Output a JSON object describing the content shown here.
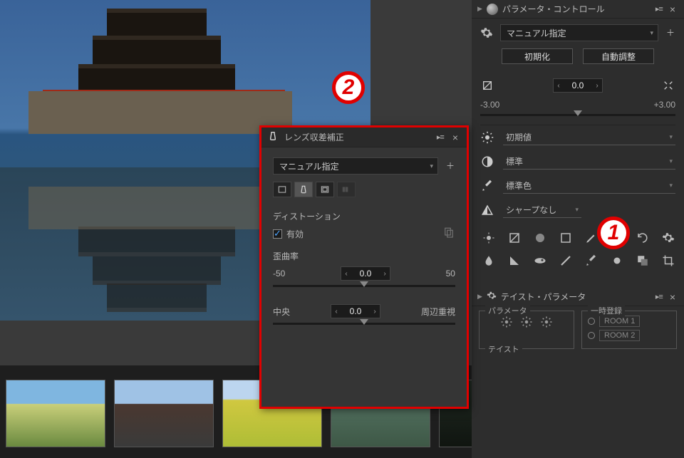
{
  "annotations": {
    "badge1": "1",
    "badge2": "2"
  },
  "rightPanel": {
    "paramControl": {
      "title": "パラメータ・コントロール",
      "preset": "マニュアル指定",
      "btnInit": "初期化",
      "btnAuto": "自動調整"
    },
    "exposure": {
      "value": "0.0",
      "min": "-3.00",
      "max": "+3.00"
    },
    "props": {
      "wb": "初期値",
      "tone": "標準",
      "color": "標準色",
      "sharp": "シャープなし"
    },
    "taste": {
      "title": "テイスト・パラメータ",
      "groupParam": "パラメータ",
      "groupTemp": "一時登録",
      "groupTaste": "テイスト",
      "room1": "ROOM 1",
      "room2": "ROOM 2"
    }
  },
  "popup": {
    "title": "レンズ収差補正",
    "preset": "マニュアル指定",
    "sectionDistortion": "ディストーション",
    "enable": "有効",
    "labelCurvature": "歪曲率",
    "curvature": {
      "value": "0.0",
      "min": "-50",
      "max": "50"
    },
    "center": {
      "labelLeft": "中央",
      "value": "0.0",
      "labelRight": "周辺重視"
    }
  }
}
